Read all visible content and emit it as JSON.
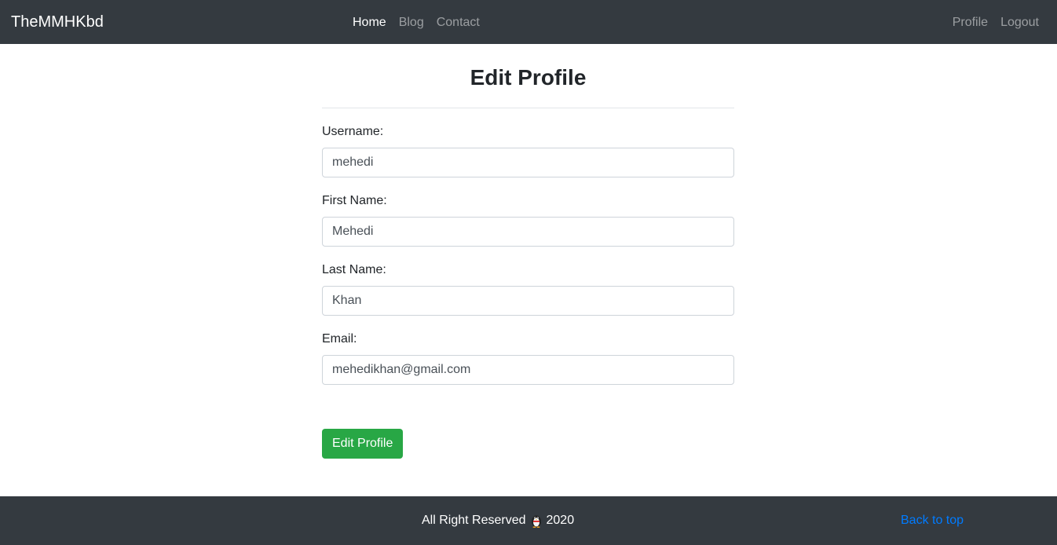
{
  "navbar": {
    "brand": "TheMMHKbd",
    "center_links": [
      {
        "label": "Home",
        "active": true
      },
      {
        "label": "Blog",
        "active": false
      },
      {
        "label": "Contact",
        "active": false
      }
    ],
    "right_links": [
      {
        "label": "Profile"
      },
      {
        "label": "Logout"
      }
    ]
  },
  "form": {
    "title": "Edit Profile",
    "fields": {
      "username": {
        "label": "Username:",
        "value": "mehedi"
      },
      "first_name": {
        "label": "First Name:",
        "value": "Mehedi"
      },
      "last_name": {
        "label": "Last Name:",
        "value": "Khan"
      },
      "email": {
        "label": "Email:",
        "value": "mehedikhan@gmail.com"
      }
    },
    "submit_label": "Edit Profile"
  },
  "footer": {
    "text_before": "All Right Reserved",
    "icon": "penguin-icon",
    "year": "2020",
    "back_to_top": "Back to top"
  },
  "colors": {
    "navbar_bg": "#343a40",
    "button_success": "#28a745",
    "link_primary": "#007bff"
  }
}
